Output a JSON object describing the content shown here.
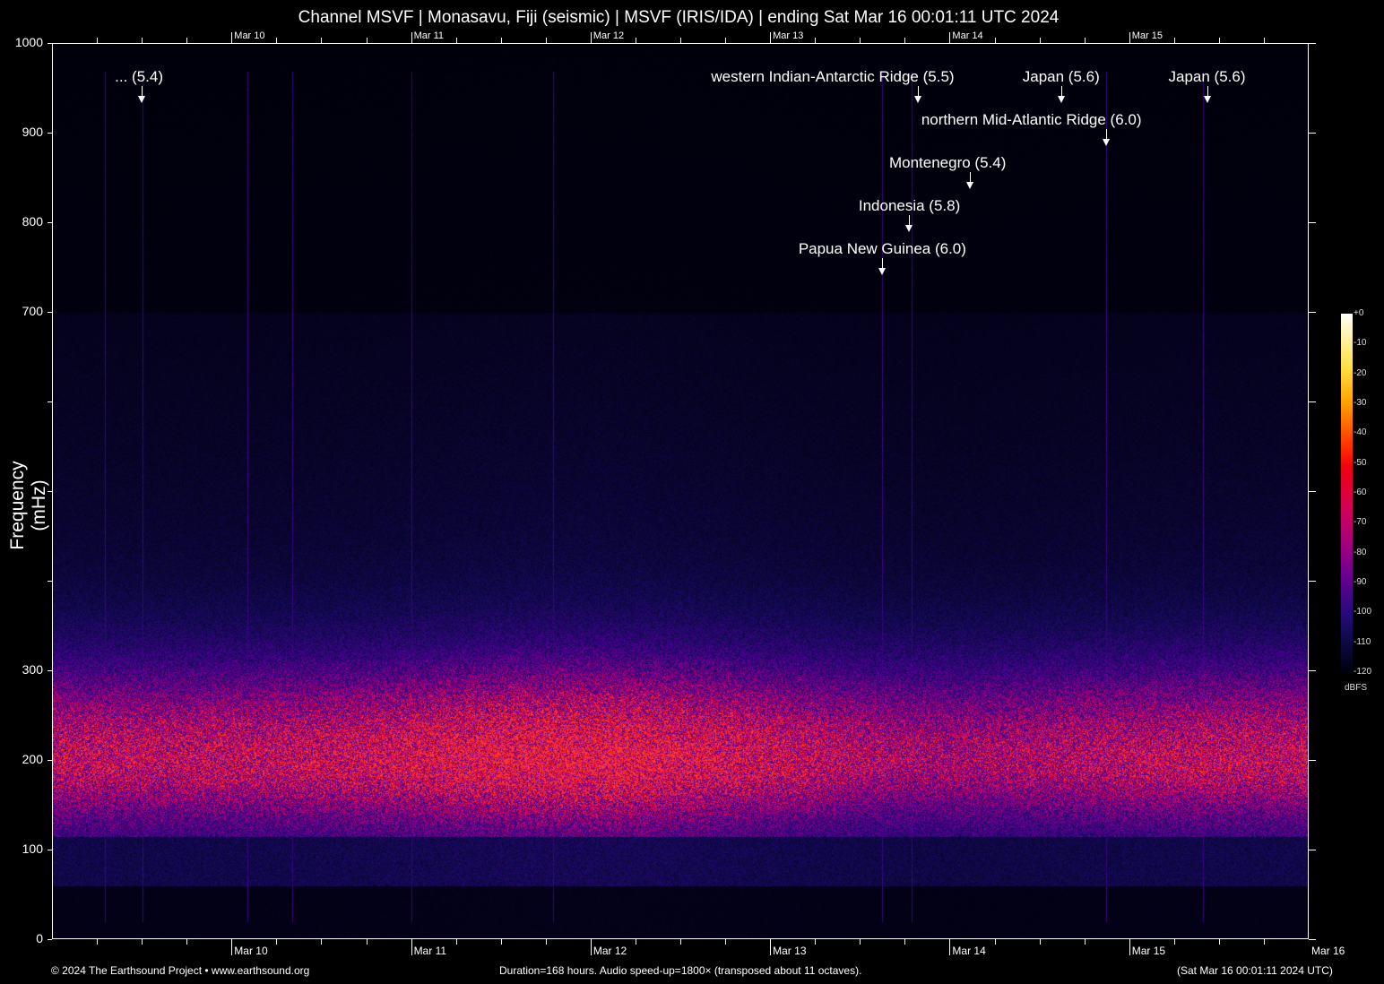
{
  "chart_data": {
    "type": "heatmap",
    "title": "Channel MSVF | Monasavu, Fiji (seismic) | MSVF (IRIS/IDA) | ending Sat Mar 16 00:01:11 UTC 2024",
    "ylabel": "Frequency (mHz)",
    "ylim": [
      0,
      1000
    ],
    "y_ticks": [
      0,
      100,
      200,
      300,
      400,
      500,
      600,
      700,
      800,
      900,
      1000
    ],
    "y_tick_labels": [
      "0",
      "100",
      "200",
      "300",
      "",
      "",
      "",
      "700",
      "800",
      "900",
      "1000"
    ],
    "x_unit": "hours from start",
    "xlim": [
      0,
      168
    ],
    "x_ticks": [
      {
        "hour": 24,
        "label": "Mar 10"
      },
      {
        "hour": 48,
        "label": "Mar 11"
      },
      {
        "hour": 72,
        "label": "Mar 12"
      },
      {
        "hour": 96,
        "label": "Mar 13"
      },
      {
        "hour": 120,
        "label": "Mar 14"
      },
      {
        "hour": 144,
        "label": "Mar 15"
      },
      {
        "hour": 168,
        "label": "Mar 16"
      }
    ],
    "colorbar": {
      "label": "dBFS",
      "ticks": [
        "+0",
        "-10",
        "-20",
        "-30",
        "-40",
        "-50",
        "-60",
        "-70",
        "-80",
        "-90",
        "-100",
        "-110",
        "-120"
      ]
    },
    "annotations": [
      {
        "label": "... (5.4)",
        "hour": 12.0
      },
      {
        "label": "western Indian-Antarctic Ridge (5.5)",
        "hour": 115.8
      },
      {
        "label": "Japan (5.6)",
        "hour": 134.9
      },
      {
        "label": "Japan (5.6)",
        "hour": 154.4
      },
      {
        "label": "northern Mid-Atlantic Ridge (6.0)",
        "hour": 140.9
      },
      {
        "label": "Montenegro (5.4)",
        "hour": 122.7
      },
      {
        "label": "Indonesia (5.8)",
        "hour": 114.6
      },
      {
        "label": "Papua New Guinea (6.0)",
        "hour": 111.0
      }
    ],
    "band_peak_mhz": 200,
    "band_peak_dbfs": -70
  },
  "footer": {
    "left": "© 2024 The Earthsound Project • www.earthsound.org",
    "center": "Duration=168 hours. Audio speed-up=1800× (transposed about 11 octaves).",
    "right": "(Sat Mar 16 00:01:11 2024 UTC)"
  }
}
